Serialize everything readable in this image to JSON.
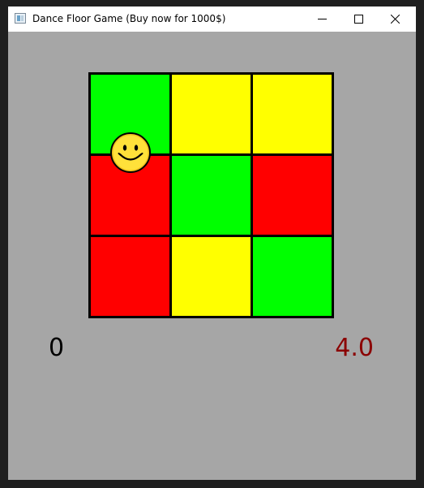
{
  "window": {
    "title": "Dance Floor Game (Buy now for 1000$)",
    "icon": "app-window-icon",
    "controls": [
      "minimize-icon",
      "maximize-icon",
      "close-icon"
    ]
  },
  "colors": {
    "green": "#00ff00",
    "yellow": "#ffff00",
    "red": "#ff0000",
    "background": "#a6a6a6",
    "grid_lines": "#000000",
    "timer_text": "#8b0000",
    "score_text": "#000000"
  },
  "board": {
    "rows": 3,
    "cols": 3,
    "tiles": [
      [
        "green",
        "yellow",
        "yellow"
      ],
      [
        "red",
        "green",
        "red"
      ],
      [
        "red",
        "yellow",
        "green"
      ]
    ],
    "player": {
      "icon": "smiley-face-icon",
      "row": 1,
      "col": 1
    }
  },
  "hud": {
    "score": "0",
    "timer": "4.0"
  }
}
